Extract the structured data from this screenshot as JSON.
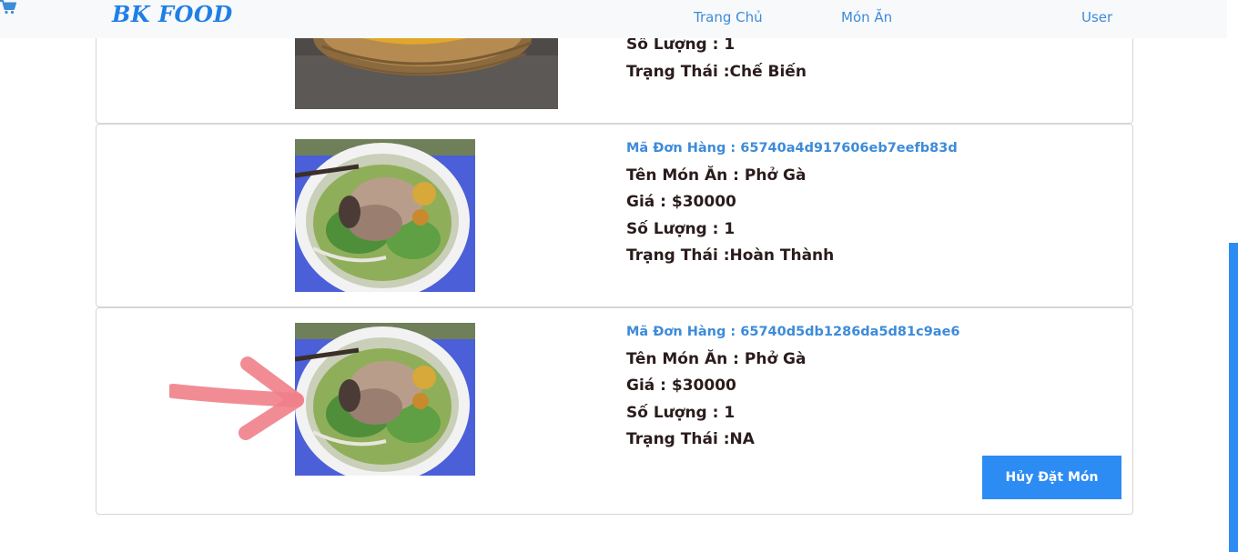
{
  "navbar": {
    "brand": "BK FOOD",
    "links": {
      "home": "Trang Chủ",
      "food": "Món Ăn",
      "user": "User"
    },
    "cart_icon": "cart-icon"
  },
  "orders": [
    {
      "quantity": "Số Lượng : 1",
      "status": "Trạng Thái :Chế Biến",
      "image": "banh-xeo-photo"
    },
    {
      "order_id": "Mã Đơn Hàng : 65740a4d917606eb7eefb83d",
      "dish_name": "Tên Món Ăn : Phở Gà",
      "price": "Giá : $30000",
      "quantity": "Số Lượng : 1",
      "status": "Trạng Thái :Hoàn Thành",
      "image": "pho-ga-photo"
    },
    {
      "order_id": "Mã Đơn Hàng : 65740d5db1286da5d81c9ae6",
      "dish_name": "Tên Món Ăn : Phở Gà",
      "price": "Giá : $30000",
      "quantity": "Số Lượng : 1",
      "status": "Trạng Thái :NA",
      "image": "pho-ga-photo",
      "cancel_label": "Hủy Đặt Món"
    }
  ],
  "colors": {
    "accent": "#2c8cf4",
    "link": "#3d8bd9",
    "text": "#2b1c1c",
    "annotation_arrow": "#ef7f8a"
  }
}
